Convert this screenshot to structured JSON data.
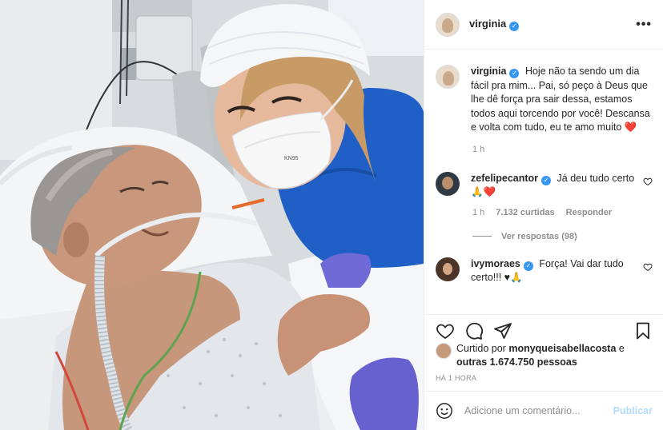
{
  "post": {
    "username": "virginia",
    "more_label": "•••"
  },
  "caption": {
    "username": "virginia",
    "text": "Hoje não ta sendo um dia fácil pra mim... Pai, só peço à Deus que lhe dê força pra sair dessa, estamos todos aqui torcendo por você! Descansa e volta com tudo, eu te amo muito",
    "emoji": "❤️",
    "time": "1 h"
  },
  "comments": [
    {
      "username": "zefelipecantor",
      "text": "Já deu tudo certo 🙏❤️",
      "time": "1 h",
      "likes": "7.132 curtidas",
      "reply_label": "Responder",
      "view_replies": "Ver respostas (98)"
    },
    {
      "username": "ivymoraes",
      "text": "Força! Vai dar tudo certo!!! ♥🙏"
    }
  ],
  "likes": {
    "prefix": "Curtido por",
    "user": "monyqueisabellacosta",
    "joiner": "e",
    "others": "outras 1.674.750 pessoas"
  },
  "timestamp": "HÁ 1 HORA",
  "add_comment": {
    "placeholder": "Adicione um comentário...",
    "publish_label": "Publicar"
  },
  "icons": {
    "like": "heart-icon",
    "comment": "comment-icon",
    "share": "share-icon",
    "save": "bookmark-icon",
    "emoji": "smiley-icon"
  },
  "colors": {
    "verified": "#3897f0",
    "muted": "#8e8e8e",
    "publish_disabled": "#b3dbff"
  }
}
